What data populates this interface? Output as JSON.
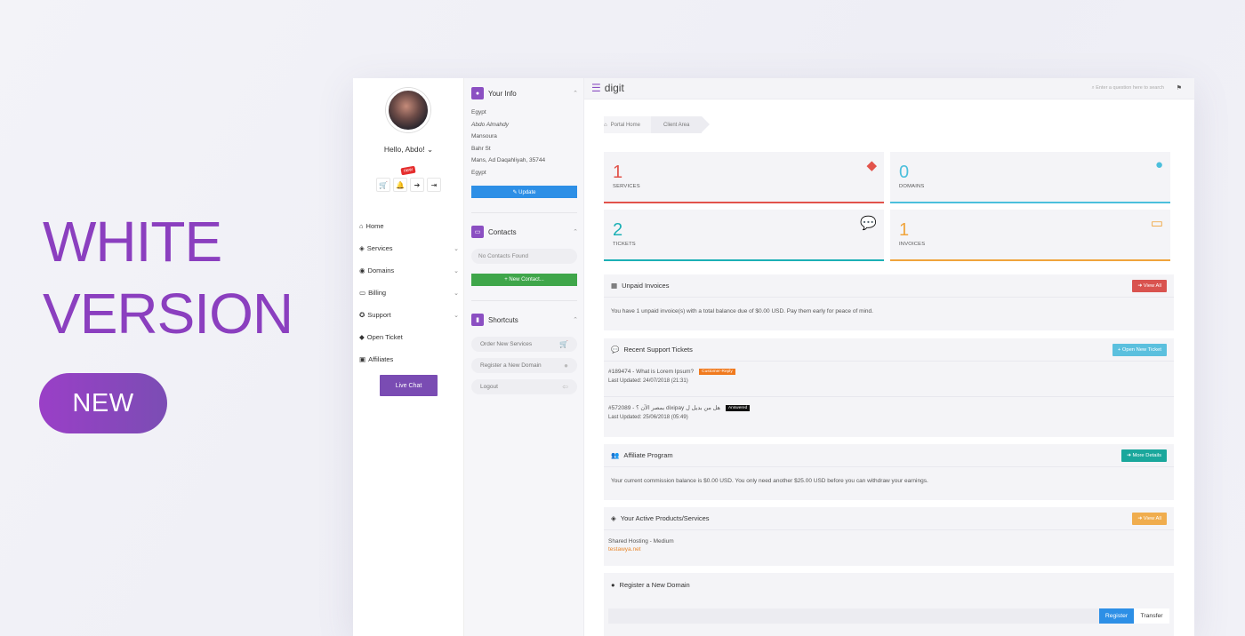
{
  "promo": {
    "line1": "WHITE",
    "line2": "VERSION",
    "badge": "NEW"
  },
  "sidebar": {
    "greeting": "Hello, Abdo!",
    "greeting_chevron": "⌄",
    "new_badge": "new",
    "icon_buttons": [
      {
        "icon": "cart-icon",
        "glyph": "🛒"
      },
      {
        "icon": "bell-icon",
        "glyph": "🔔"
      },
      {
        "icon": "arrow-right-icon",
        "glyph": "➔"
      },
      {
        "icon": "logout-icon",
        "glyph": "⇥"
      }
    ],
    "nav": [
      {
        "label": "Home",
        "glyph": "⌂",
        "has_chevron": false
      },
      {
        "label": "Services",
        "glyph": "◈",
        "has_chevron": true
      },
      {
        "label": "Domains",
        "glyph": "◉",
        "has_chevron": true
      },
      {
        "label": "Billing",
        "glyph": "▭",
        "has_chevron": true
      },
      {
        "label": "Support",
        "glyph": "✪",
        "has_chevron": true
      },
      {
        "label": "Open Ticket",
        "glyph": "◆",
        "has_chevron": false
      },
      {
        "label": "Affiliates",
        "glyph": "▣",
        "has_chevron": false
      }
    ],
    "live_chat": "Live Chat"
  },
  "your_info": {
    "title": "Your Info",
    "lines": [
      "Egypt",
      "Abdo Almahdy",
      "Mansoura",
      "Bahr St",
      "Mans, Ad Daqahliyah, 35744",
      "Egypt"
    ],
    "update_button": "✎ Update"
  },
  "contacts": {
    "title": "Contacts",
    "empty": "No Contacts Found",
    "new_button": "+ New Contact..."
  },
  "shortcuts": {
    "title": "Shortcuts",
    "items": [
      {
        "label": "Order New Services",
        "glyph": "🛒"
      },
      {
        "label": "Register a New Domain",
        "glyph": "●"
      },
      {
        "label": "Logout",
        "glyph": "⇦"
      }
    ]
  },
  "topbar": {
    "logo": "digit",
    "search_placeholder": "Enter a question here to search",
    "lang_glyph": "⚑"
  },
  "breadcrumb": {
    "home": "Portal Home",
    "current": "Client Area"
  },
  "stats": [
    {
      "value": "1",
      "label": "SERVICES",
      "color": "#e2534b",
      "glyph": "◆"
    },
    {
      "value": "0",
      "label": "DOMAINS",
      "color": "#4cbfdc",
      "glyph": "●"
    },
    {
      "value": "2",
      "label": "TICKETS",
      "color": "#1cb0b5",
      "glyph": "💬"
    },
    {
      "value": "1",
      "label": "INVOICES",
      "color": "#f0a43c",
      "glyph": "▭"
    }
  ],
  "unpaid": {
    "title": "Unpaid Invoices",
    "button": "➜ View All",
    "body": "You have 1 unpaid invoice(s) with a total balance due of $0.00 USD. Pay them early for peace of mind."
  },
  "tickets": {
    "title": "Recent Support Tickets",
    "button": "+ Open New Ticket",
    "items": [
      {
        "subject": "#189474 - What is Lorem Ipsum?",
        "status": "Customer-Reply",
        "status_color": "#f07a1e",
        "updated": "Last Updated: 24/07/2018 (21:31)"
      },
      {
        "subject": "#572089 - بمصر الآن ؟ dixipay هل من بديل ل",
        "status": "Answered",
        "status_color": "#111111",
        "updated": "Last Updated: 25/06/2018 (05:49)"
      }
    ]
  },
  "affiliate": {
    "title": "Affiliate Program",
    "button": "➜ More Details",
    "body": "Your current commission balance is $0.00 USD. You only need another $25.00 USD before you can withdraw your earnings."
  },
  "products": {
    "title": "Your Active Products/Services",
    "button": "➜ View All",
    "name": "Shared Hosting - Medium",
    "domain": "testawya.net"
  },
  "register_domain": {
    "title": "Register a New Domain",
    "register": "Register",
    "transfer": "Transfer"
  }
}
